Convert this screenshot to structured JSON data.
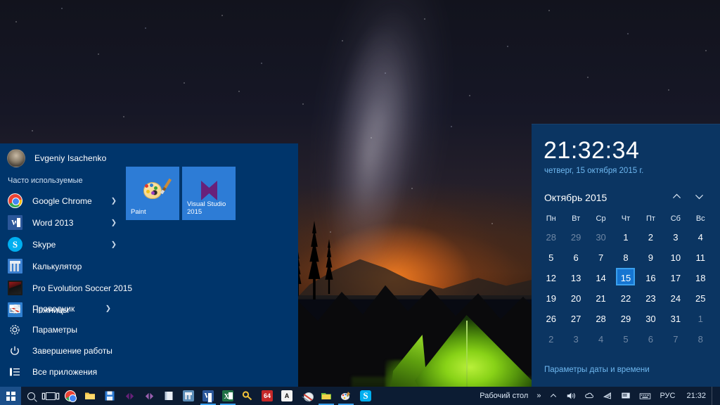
{
  "start_menu": {
    "user_name": "Evgeniy Isachenko",
    "avatar_icon": "user-avatar-photo",
    "frequent_label": "Часто используемые",
    "apps": [
      {
        "label": "Google Chrome",
        "icon": "chrome-icon",
        "has_submenu": true
      },
      {
        "label": "Word 2013",
        "icon": "word-icon",
        "has_submenu": true
      },
      {
        "label": "Skype",
        "icon": "skype-icon",
        "has_submenu": true
      },
      {
        "label": "Калькулятор",
        "icon": "calculator-icon",
        "has_submenu": false
      },
      {
        "label": "Pro Evolution Soccer 2015",
        "icon": "pes-game-icon",
        "has_submenu": false
      },
      {
        "label": "Ножницы",
        "icon": "snipping-tool-icon",
        "has_submenu": false
      }
    ],
    "bottom_items": [
      {
        "label": "Проводник",
        "icon": "file-explorer-icon",
        "has_submenu": true
      },
      {
        "label": "Параметры",
        "icon": "gear-icon",
        "has_submenu": false
      },
      {
        "label": "Завершение работы",
        "icon": "power-icon",
        "has_submenu": false
      },
      {
        "label": "Все приложения",
        "icon": "all-apps-list-icon",
        "has_submenu": false
      }
    ],
    "tiles": [
      {
        "label": "Paint",
        "icon": "paint-palette-icon",
        "color": "#2d7cd6"
      },
      {
        "label": "Visual Studio 2015",
        "icon": "visual-studio-icon",
        "color": "#2d7cd6"
      }
    ],
    "background_color": "#00356b"
  },
  "clock_flyout": {
    "time": "21:32:34",
    "date": "четверг, 15 октября 2015 г.",
    "month_title": "Октябрь 2015",
    "prev_icon": "chevron-up-icon",
    "next_icon": "chevron-down-icon",
    "weekdays": [
      "Пн",
      "Вт",
      "Ср",
      "Чт",
      "Пт",
      "Сб",
      "Вс"
    ],
    "weeks": [
      [
        {
          "d": "28",
          "m": true
        },
        {
          "d": "29",
          "m": true
        },
        {
          "d": "30",
          "m": true
        },
        {
          "d": "1",
          "m": false
        },
        {
          "d": "2",
          "m": false
        },
        {
          "d": "3",
          "m": false
        },
        {
          "d": "4",
          "m": false
        }
      ],
      [
        {
          "d": "5",
          "m": false
        },
        {
          "d": "6",
          "m": false
        },
        {
          "d": "7",
          "m": false
        },
        {
          "d": "8",
          "m": false
        },
        {
          "d": "9",
          "m": false
        },
        {
          "d": "10",
          "m": false
        },
        {
          "d": "11",
          "m": false
        }
      ],
      [
        {
          "d": "12",
          "m": false
        },
        {
          "d": "13",
          "m": false
        },
        {
          "d": "14",
          "m": false
        },
        {
          "d": "15",
          "m": false,
          "sel": true
        },
        {
          "d": "16",
          "m": false
        },
        {
          "d": "17",
          "m": false
        },
        {
          "d": "18",
          "m": false
        }
      ],
      [
        {
          "d": "19",
          "m": false
        },
        {
          "d": "20",
          "m": false
        },
        {
          "d": "21",
          "m": false
        },
        {
          "d": "22",
          "m": false
        },
        {
          "d": "23",
          "m": false
        },
        {
          "d": "24",
          "m": false
        },
        {
          "d": "25",
          "m": false
        }
      ],
      [
        {
          "d": "26",
          "m": false
        },
        {
          "d": "27",
          "m": false
        },
        {
          "d": "28",
          "m": false
        },
        {
          "d": "29",
          "m": false
        },
        {
          "d": "30",
          "m": false
        },
        {
          "d": "31",
          "m": false
        },
        {
          "d": "1",
          "m": true
        }
      ],
      [
        {
          "d": "2",
          "m": true
        },
        {
          "d": "3",
          "m": true
        },
        {
          "d": "4",
          "m": true
        },
        {
          "d": "5",
          "m": true
        },
        {
          "d": "6",
          "m": true
        },
        {
          "d": "7",
          "m": true
        },
        {
          "d": "8",
          "m": true
        }
      ]
    ],
    "settings_link": "Параметры даты и времени",
    "selected_day": "15",
    "accent_color": "#1675d1",
    "background_color": "#0b3562"
  },
  "taskbar": {
    "start_icon": "windows-start-icon",
    "search_icon": "search-icon",
    "task_view_icon": "task-view-icon",
    "pinned": [
      {
        "icon": "chrome-icon",
        "active": false
      },
      {
        "icon": "file-explorer-icon",
        "active": false
      },
      {
        "icon": "save-floppy-icon",
        "active": false
      },
      {
        "icon": "visual-studio-icon",
        "active": false
      },
      {
        "icon": "visual-studio-alt-icon",
        "active": false
      },
      {
        "icon": "notebook-icon",
        "active": false
      },
      {
        "icon": "calculator-icon",
        "active": false
      },
      {
        "icon": "word-icon",
        "active": true
      },
      {
        "icon": "excel-icon",
        "active": true
      },
      {
        "icon": "key-icon",
        "active": false
      },
      {
        "icon": "64-app-icon",
        "active": false
      },
      {
        "icon": "letter-a-icon",
        "active": false
      },
      {
        "icon": "snipping-tool-icon",
        "active": false
      },
      {
        "icon": "folder-icon",
        "active": true
      },
      {
        "icon": "paint-palette-icon",
        "active": true
      },
      {
        "icon": "skype-icon",
        "active": false
      }
    ],
    "tray": {
      "desktop_label": "Рабочий стол",
      "overflow_icon": "double-chevron-right-icon",
      "hidden_icons_icon": "chevron-up-icon",
      "volume_icon": "speaker-icon",
      "onedrive_icon": "onedrive-cloud-icon",
      "network_icon": "wifi-icon",
      "action_center_icon": "action-center-icon",
      "keyboard_icon": "keyboard-icon",
      "language": "РУС",
      "clock": "21:32"
    }
  },
  "wallpaper": {
    "description": "night-sky-milky-way-tent"
  }
}
